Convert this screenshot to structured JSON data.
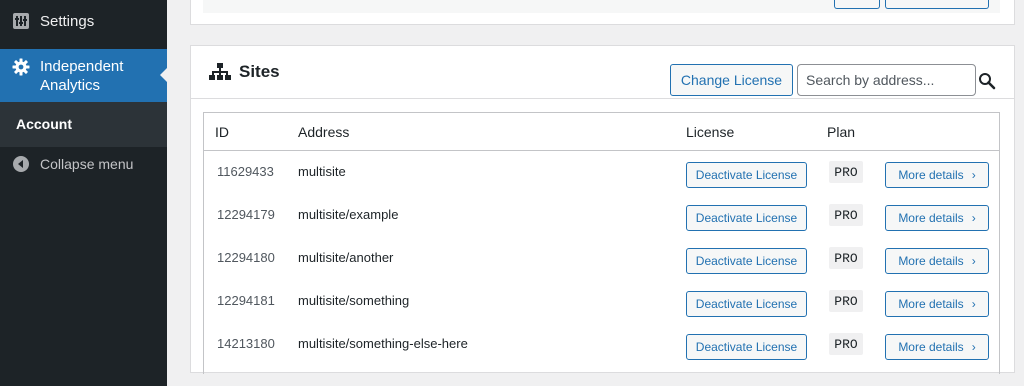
{
  "sidebar": {
    "settings_label": "Settings",
    "settings_icon": "settings-sliders-icon",
    "active_label": "Independent Analytics",
    "active_icon": "gear-icon",
    "submenu_account": "Account",
    "collapse_label": "Collapse menu",
    "collapse_icon": "collapse-arrow-icon",
    "active_color": "#2271b1"
  },
  "sites": {
    "title": "Sites",
    "title_icon": "sitemap-icon",
    "change_license_label": "Change License",
    "search_placeholder": "Search by address...",
    "search_icon": "search-icon",
    "columns": {
      "id": "ID",
      "address": "Address",
      "license": "License",
      "plan": "Plan"
    },
    "rows": [
      {
        "id": "11629433",
        "address": "multisite",
        "license_action": "Deactivate License",
        "plan": "PRO",
        "details_label": "More details"
      },
      {
        "id": "12294179",
        "address": "multisite/example",
        "license_action": "Deactivate License",
        "plan": "PRO",
        "details_label": "More details"
      },
      {
        "id": "12294180",
        "address": "multisite/another",
        "license_action": "Deactivate License",
        "plan": "PRO",
        "details_label": "More details"
      },
      {
        "id": "12294181",
        "address": "multisite/something",
        "license_action": "Deactivate License",
        "plan": "PRO",
        "details_label": "More details"
      },
      {
        "id": "14213180",
        "address": "multisite/something-else-here",
        "license_action": "Deactivate License",
        "plan": "PRO",
        "details_label": "More details"
      }
    ]
  }
}
